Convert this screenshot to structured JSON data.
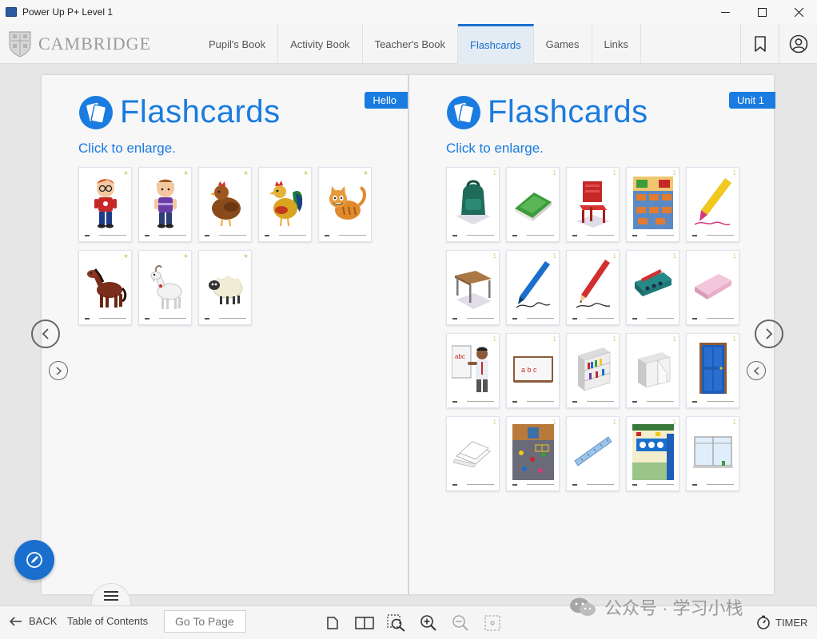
{
  "window": {
    "title": "Power Up P+ Level 1",
    "controls": [
      "—",
      "☐",
      "✕"
    ]
  },
  "header": {
    "logo_text": "CAMBRIDGE",
    "tabs": [
      {
        "label": "Pupil's Book",
        "active": false
      },
      {
        "label": "Activity Book",
        "active": false
      },
      {
        "label": "Teacher's Book",
        "active": false
      },
      {
        "label": "Flashcards",
        "active": true
      },
      {
        "label": "Games",
        "active": false
      },
      {
        "label": "Links",
        "active": false
      }
    ],
    "icons": [
      "bookmark-icon",
      "user-icon"
    ]
  },
  "left_page": {
    "tag": "Hello",
    "title": "Flashcards",
    "subtitle": "Click to enlarge.",
    "cards": [
      "boy-glasses",
      "boy-purple",
      "hen",
      "rooster",
      "cat",
      "horse",
      "goat",
      "sheep"
    ]
  },
  "right_page": {
    "tag": "Unit 1",
    "title": "Flashcards",
    "subtitle": "Click to enlarge.",
    "cards": [
      "backpack",
      "book",
      "chair",
      "classroom",
      "crayon",
      "table",
      "pen",
      "pencil",
      "pencil-case",
      "eraser",
      "teacher",
      "board",
      "bookcase",
      "cupboard",
      "door",
      "paper",
      "playground",
      "ruler",
      "wall",
      "window"
    ]
  },
  "footer": {
    "back_label": "BACK",
    "toc_label": "Table of Contents",
    "goto_placeholder": "Go To Page",
    "watermark": "公众号 · 学习小栈",
    "timer_label": "TIMER"
  },
  "colors": {
    "accent": "#1a7be0",
    "pen_button": "#1a6fce",
    "active_tab_bg": "#e3ebf5"
  }
}
